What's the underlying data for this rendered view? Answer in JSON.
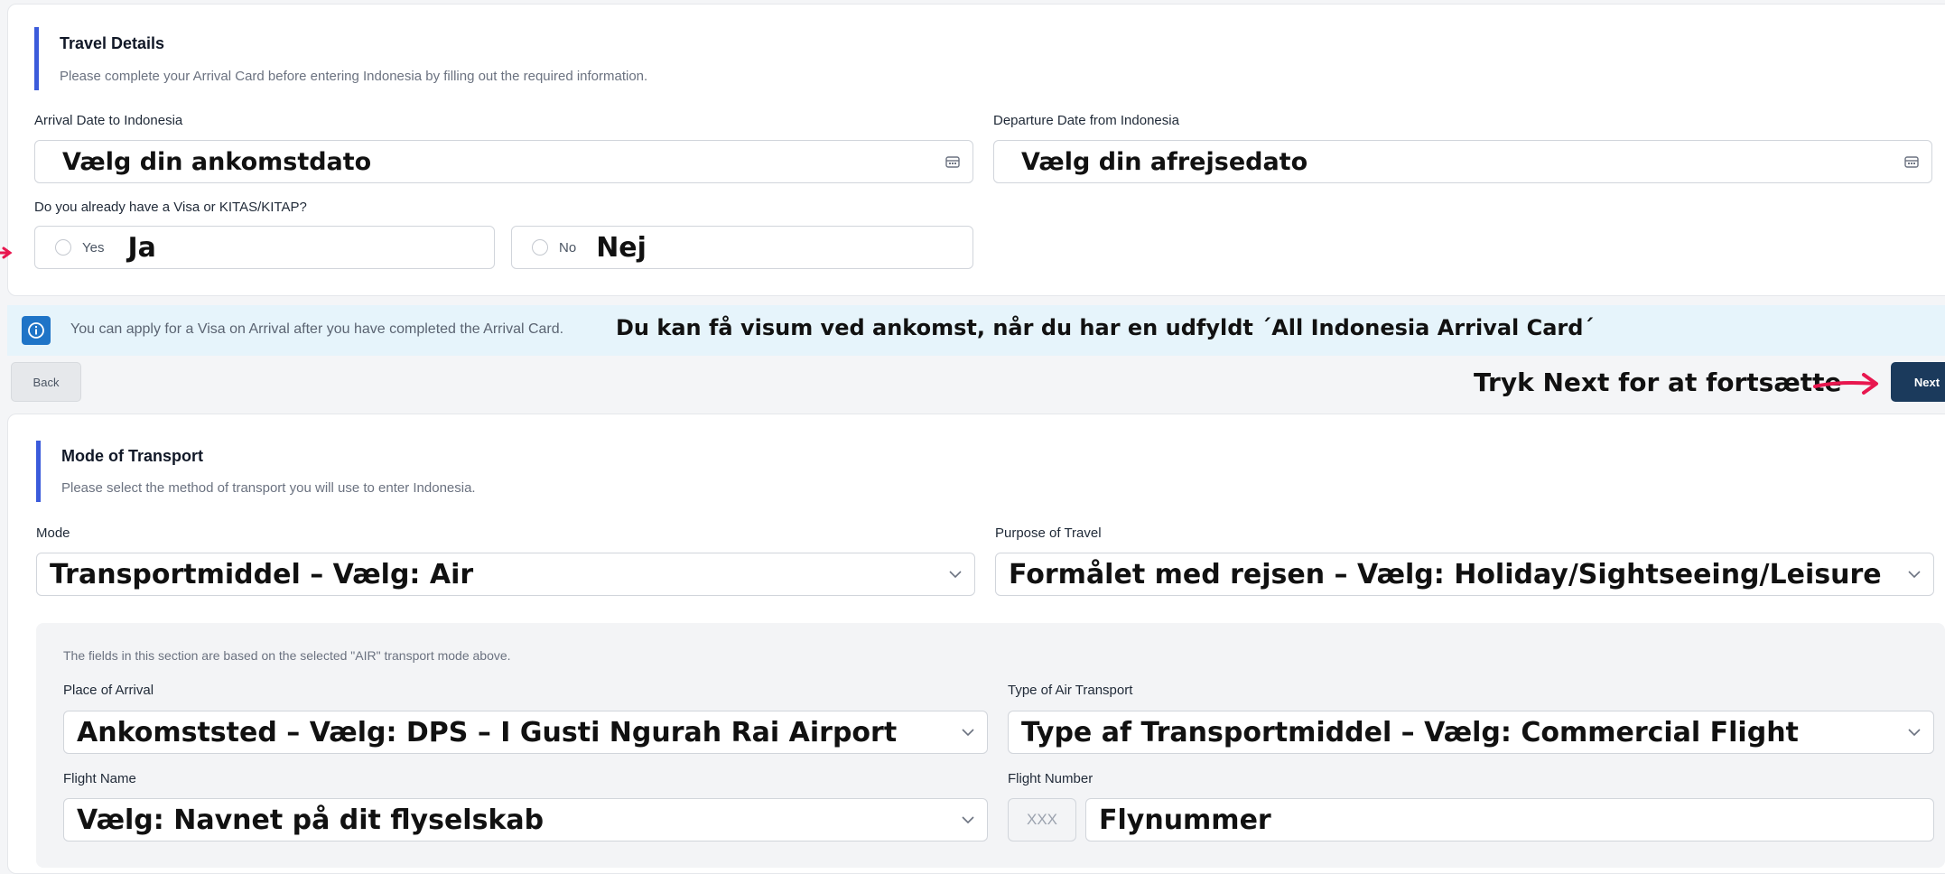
{
  "travel": {
    "title": "Travel Details",
    "subtitle": "Please complete your Arrival Card before entering Indonesia by filling out the required information.",
    "arrival_label": "Arrival Date to Indonesia",
    "arrival_annotation": "Vælg din ankomstdato",
    "departure_label": "Departure Date from Indonesia",
    "departure_annotation": "Vælg din afrejsedato",
    "visa_question": "Do you already have a Visa or KITAS/KITAP?",
    "yes_label": "Yes",
    "yes_annotation": "Ja",
    "no_label": "No",
    "no_annotation": "Nej"
  },
  "info": {
    "text": "You can apply for a Visa on Arrival after you have completed the Arrival Card.",
    "annotation": "Du kan få visum ved ankomst, når du har en udfyldt ´All Indonesia Arrival Card´",
    "icon": "info-icon"
  },
  "nav": {
    "back_label": "Back",
    "next_label": "Next",
    "next_annotation": "Tryk Next for at fortsætte"
  },
  "transport": {
    "title": "Mode of Transport",
    "subtitle": "Please select the method of transport you will use to enter Indonesia.",
    "mode_label": "Mode",
    "mode_annotation": "Transportmiddel – Vælg: Air",
    "purpose_label": "Purpose of Travel",
    "purpose_annotation": "Formålet med rejsen – Vælg: Holiday/Sightseeing/Leisure",
    "section_note": "The fields in this section are based on the selected \"AIR\" transport mode above.",
    "place_label": "Place of Arrival",
    "place_annotation": "Ankomststed – Vælg: DPS – I Gusti Ngurah Rai Airport",
    "type_label": "Type of Air Transport",
    "type_annotation": "Type af Transportmiddel – Vælg: Commercial Flight",
    "flight_name_label": "Flight Name",
    "flight_name_annotation": "Vælg: Navnet på dit flyselskab",
    "flight_number_label": "Flight Number",
    "flight_number_prefix": "XXX",
    "flight_number_annotation": "Flynummer"
  },
  "colors": {
    "accent": "#3b5bdb",
    "next_button": "#1b3a5c",
    "info_bg": "#e6f4fb",
    "arrow": "#e8174f"
  }
}
